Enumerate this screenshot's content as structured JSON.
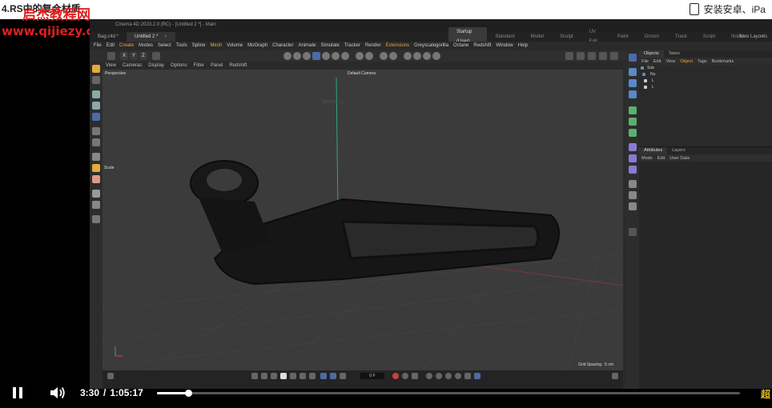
{
  "overlay": {
    "lesson_title": "4.RS中的复合材质",
    "watermark_name": "启杰教程网",
    "watermark_url": "www.qijiezy.com",
    "watermark_corner": "超",
    "install_text": "安装安卓、iPa"
  },
  "app": {
    "title": "Cinema 4D 2023.2.0 (RC) - [Untitled 2 *] - Main",
    "doc_tabs": [
      {
        "label": "Bag.c4d *",
        "active": false
      },
      {
        "label": "Untitled 2 *",
        "active": true
      }
    ],
    "layout_tabs": [
      {
        "label": "Startup (User)",
        "active": true
      },
      {
        "label": "Standard",
        "active": false
      },
      {
        "label": "Model",
        "active": false
      },
      {
        "label": "Sculpt",
        "active": false
      },
      {
        "label": "UV Edit",
        "active": false
      },
      {
        "label": "Paint",
        "active": false
      },
      {
        "label": "Groom",
        "active": false
      },
      {
        "label": "Track",
        "active": false
      },
      {
        "label": "Script",
        "active": false
      },
      {
        "label": "Nodes",
        "active": false
      },
      {
        "label": "+",
        "active": false
      }
    ],
    "new_layouts": "New Layouts",
    "menu": [
      "File",
      "Edit",
      "Create",
      "Modes",
      "Select",
      "Tools",
      "Spline",
      "Mesh",
      "Volume",
      "MoGraph",
      "Character",
      "Animate",
      "Simulate",
      "Tracker",
      "Render",
      "Extensions",
      "Greyscalegorilla",
      "Octane",
      "Redshift",
      "Window",
      "Help"
    ],
    "menu_highlight": [
      "Create",
      "Mesh",
      "Extensions"
    ],
    "toolbar_letters": [
      "X",
      "Y",
      "Z"
    ],
    "view_menu": [
      "View",
      "Cameras",
      "Display",
      "Options",
      "Filter",
      "Panel",
      "Redshift"
    ]
  },
  "viewport": {
    "perspective_label": "Perspective",
    "camera_label": "Default Camera",
    "scale_label": "Scale",
    "center_label": "00/00/00 1.2",
    "grid_spacing": "Grid Spacing : 5 cm"
  },
  "timeline": {
    "frame_value": "0 F"
  },
  "objects_panel": {
    "tabs": [
      {
        "label": "Objects",
        "active": true
      },
      {
        "label": "Takes",
        "active": false
      }
    ],
    "menu": [
      "File",
      "Edit",
      "View",
      "Object",
      "Tags",
      "Bookmarks"
    ],
    "menu_highlight": [
      "Object"
    ],
    "rows": [
      "Sub",
      "Nu",
      "L",
      "L"
    ]
  },
  "attr_panel": {
    "tabs": [
      {
        "label": "Attributes",
        "active": true
      },
      {
        "label": "Layers",
        "active": false
      }
    ],
    "menu": [
      "Mode",
      "Edit",
      "User Data"
    ]
  },
  "player": {
    "current_time": "3:30",
    "separator": "/",
    "duration": "1:05:17",
    "progress_fraction": 0.0536
  },
  "colors": {
    "accent_orange": "#e7a93c",
    "watermark_red": "#e02020",
    "viewport_bg": "#3b3b3b"
  }
}
